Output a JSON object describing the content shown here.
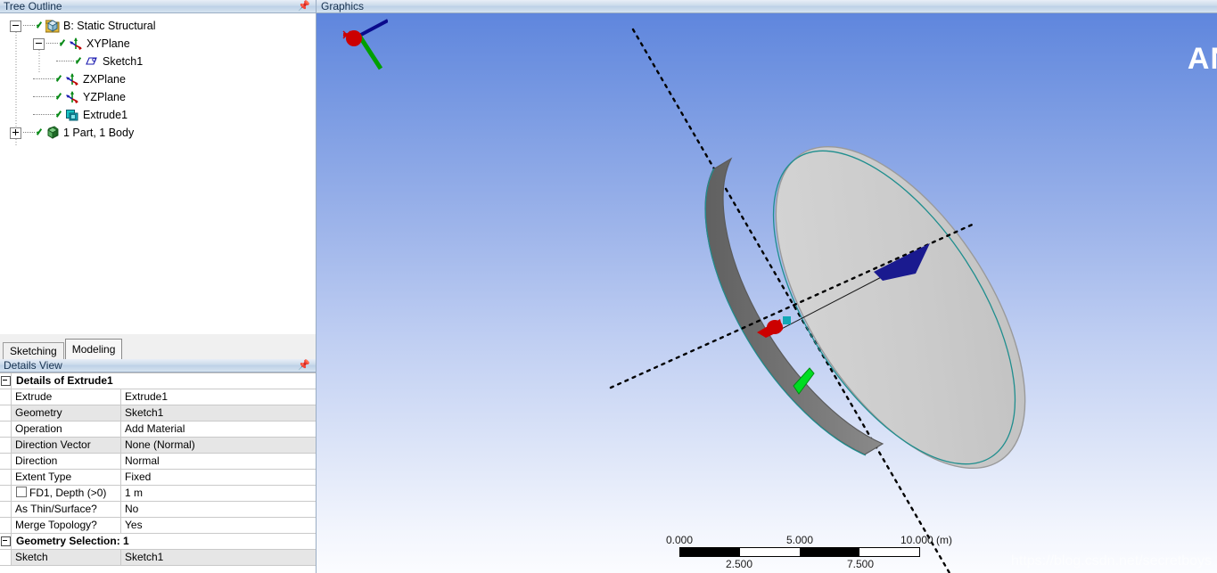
{
  "tree_panel": {
    "title": "Tree Outline",
    "pin_icon": "pin-icon",
    "items": [
      {
        "label": "B: Static Structural",
        "depth": 0,
        "toggle": "minus",
        "icon": "project-icon",
        "checked": true
      },
      {
        "label": "XYPlane",
        "depth": 1,
        "toggle": "minus",
        "icon": "plane-icon",
        "checked": true
      },
      {
        "label": "Sketch1",
        "depth": 2,
        "toggle": "none",
        "icon": "sketch-icon",
        "checked": true
      },
      {
        "label": "ZXPlane",
        "depth": 1,
        "toggle": "none",
        "icon": "plane-icon",
        "checked": true
      },
      {
        "label": "YZPlane",
        "depth": 1,
        "toggle": "none",
        "icon": "plane-icon",
        "checked": true
      },
      {
        "label": "Extrude1",
        "depth": 1,
        "toggle": "none",
        "icon": "extrude-icon",
        "checked": true
      },
      {
        "label": "1 Part, 1 Body",
        "depth": 0,
        "toggle": "plus",
        "icon": "body-icon",
        "checked": true
      }
    ]
  },
  "tabs": {
    "sketching": "Sketching",
    "modeling": "Modeling",
    "active": "Modeling"
  },
  "details_panel": {
    "title": "Details View",
    "pin_icon": "pin-icon",
    "rows": [
      {
        "type": "header",
        "gutter": "minus",
        "label": "Details of Extrude1"
      },
      {
        "type": "pair",
        "name": "Extrude",
        "value": "Extrude1",
        "alt": false
      },
      {
        "type": "pair",
        "name": "Geometry",
        "value": "Sketch1",
        "alt": true
      },
      {
        "type": "pair",
        "name": "Operation",
        "value": "Add Material",
        "alt": false
      },
      {
        "type": "pair",
        "name": "Direction Vector",
        "value": "None (Normal)",
        "alt": true
      },
      {
        "type": "pair",
        "name": "Direction",
        "value": "Normal",
        "alt": false
      },
      {
        "type": "pair",
        "name": "Extent Type",
        "value": "Fixed",
        "alt": false
      },
      {
        "type": "pair-check",
        "name": "FD1,  Depth (>0)",
        "value": "1 m",
        "alt": false
      },
      {
        "type": "pair",
        "name": "As Thin/Surface?",
        "value": "No",
        "alt": false
      },
      {
        "type": "pair",
        "name": "Merge Topology?",
        "value": "Yes",
        "alt": false
      },
      {
        "type": "header",
        "gutter": "minus",
        "label": "Geometry Selection: 1"
      },
      {
        "type": "pair",
        "name": "Sketch",
        "value": "Sketch1",
        "alt": true
      }
    ]
  },
  "graphics": {
    "title": "Graphics",
    "logo_text": "AN",
    "watermark": "https://blog.csdn.net/secretboys",
    "triad": {
      "x_axis_color": "#cc0000",
      "y_axis_color": "#00a000",
      "z_axis_color": "#0a0a8c"
    },
    "background_top_color": "#5f86dd",
    "background_bottom_color": "#fbfcff",
    "model": {
      "body_face_color": "#cfcfcf",
      "body_side_color": "#6f6f6f",
      "sketch_edge_color": "#1f8e8e",
      "axis_line_color": "#000000",
      "arrow_x_color": "#cc0000",
      "arrow_y_color": "#00d000",
      "arrow_z_color": "#1a1a8f"
    }
  },
  "scalebar": {
    "ticks_top": [
      "0.000",
      "5.000",
      "10.000 (m)"
    ],
    "ticks_bottom": [
      "2.500",
      "7.500"
    ],
    "segments": [
      "dark",
      "light",
      "dark",
      "light"
    ]
  }
}
